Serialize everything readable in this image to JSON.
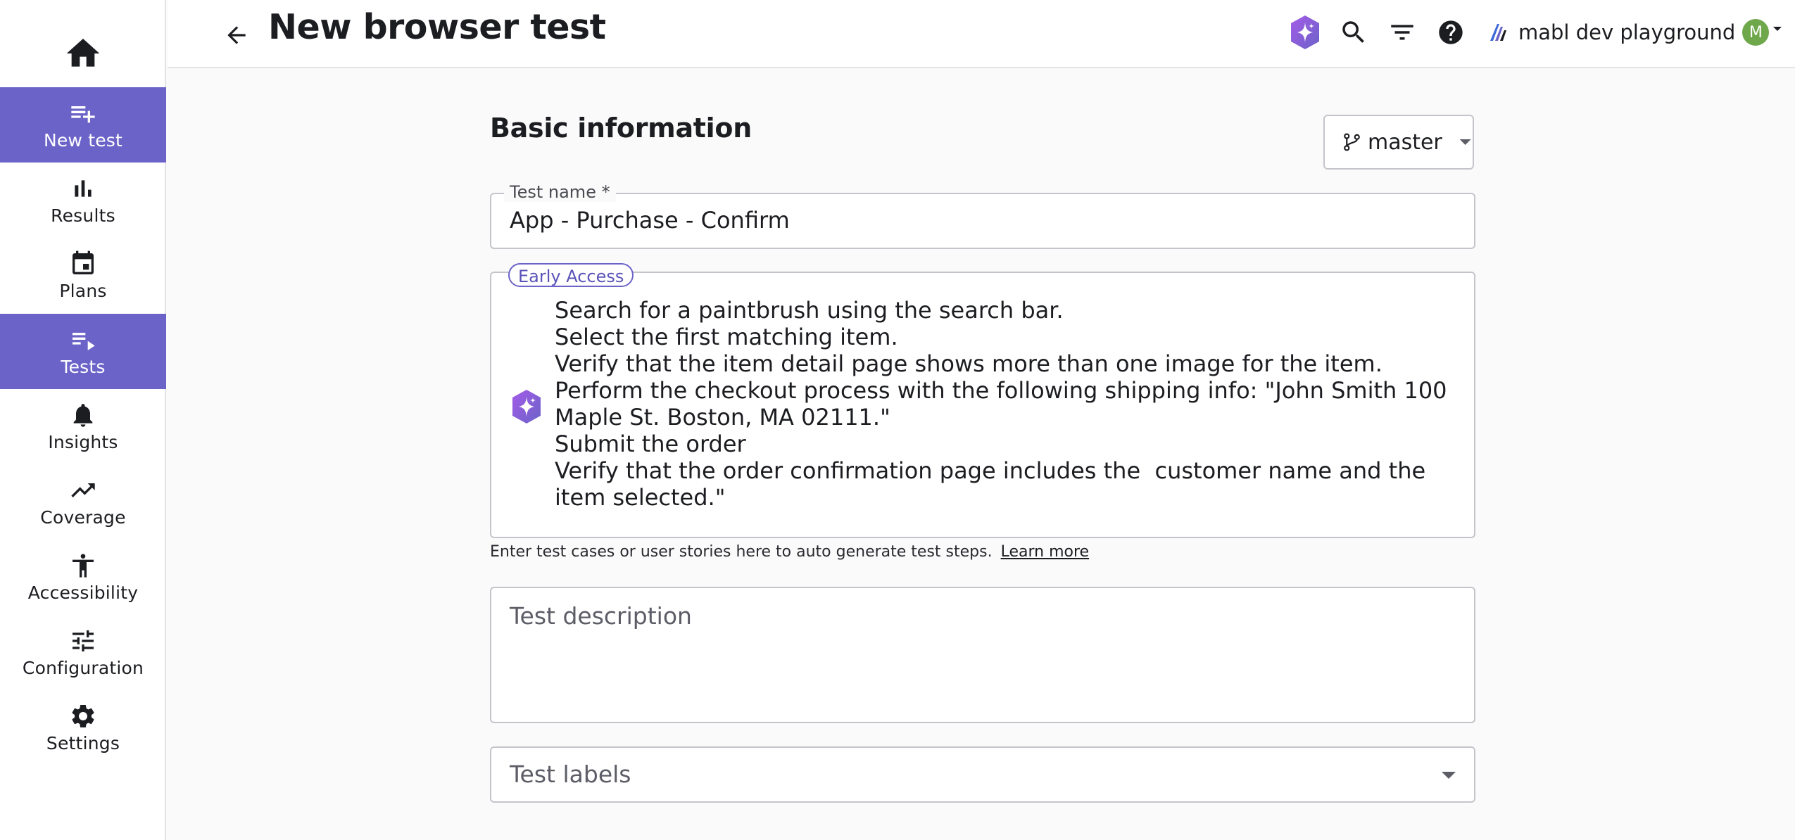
{
  "header": {
    "title": "New browser test",
    "workspace_name": "mabl dev playground",
    "avatar_initial": "M"
  },
  "sidebar": {
    "items": [
      {
        "label": "New test",
        "icon": "playlist-add-icon",
        "active": true
      },
      {
        "label": "Results",
        "icon": "bar-chart-icon",
        "active": false
      },
      {
        "label": "Plans",
        "icon": "calendar-icon",
        "active": false
      },
      {
        "label": "Tests",
        "icon": "playlist-play-icon",
        "active": true
      },
      {
        "label": "Insights",
        "icon": "bell-icon",
        "active": false
      },
      {
        "label": "Coverage",
        "icon": "trending-up-icon",
        "active": false
      },
      {
        "label": "Accessibility",
        "icon": "accessibility-icon",
        "active": false
      },
      {
        "label": "Configuration",
        "icon": "tune-icon",
        "active": false
      },
      {
        "label": "Settings",
        "icon": "gear-icon",
        "active": false
      }
    ]
  },
  "main": {
    "section_title": "Basic information",
    "branch": "master",
    "test_name": {
      "label": "Test name *",
      "value": "App - Purchase - Confirm"
    },
    "ai_prompt": {
      "badge": "Early Access",
      "lines": [
        "Search for a paintbrush using the search bar.",
        "Select the first matching item.",
        "Verify that the item detail page shows more than one image for the item.",
        "Perform the checkout process with the following shipping info: \"John Smith 100 Maple St. Boston, MA 02111.\"",
        "Submit the order",
        "Verify that the order confirmation page includes the  customer name and the item selected.\""
      ],
      "helper_text": "Enter test cases or user stories here to auto generate test steps.",
      "learn_more": "Learn more"
    },
    "description_placeholder": "Test description",
    "labels_placeholder": "Test labels"
  },
  "colors": {
    "accent": "#6b63c8",
    "ai_gradient_start": "#9b5de5",
    "ai_gradient_end": "#6b63c8",
    "avatar": "#6fa84a"
  }
}
